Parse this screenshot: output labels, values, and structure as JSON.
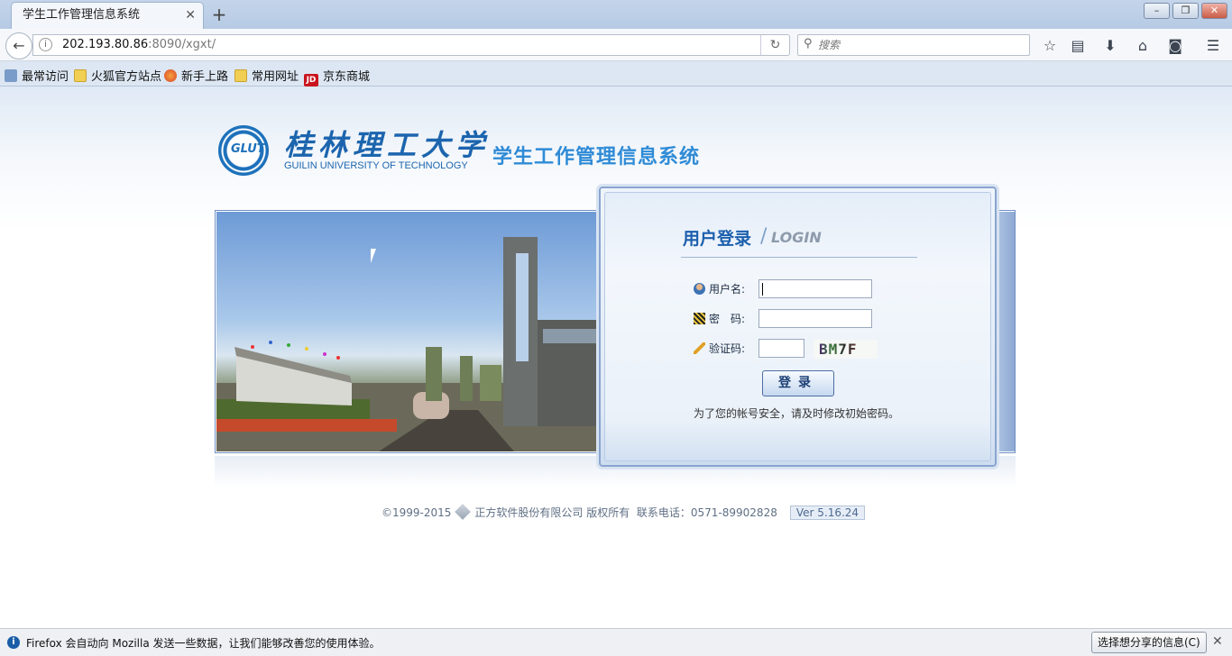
{
  "browser": {
    "tab_title": "学生工作管理信息系统",
    "tab_close": "✕",
    "new_tab": "+",
    "url_host": "202.193.80.86",
    "url_rest": ":8090/xgxt/",
    "search_placeholder": "搜索",
    "window_buttons": [
      "–",
      "❐",
      "✕"
    ],
    "bookmarks": [
      "最常访问",
      "火狐官方站点",
      "新手上路",
      "常用网址",
      "京东商城"
    ],
    "jd_label": "JD"
  },
  "header": {
    "school_name_cn": "桂林理工大学",
    "school_name_en": "GUILIN UNIVERSITY OF TECHNOLOGY",
    "seal_text": "GLUT",
    "system_title": "学生工作管理信息系统"
  },
  "login": {
    "title": "用户登录",
    "separator": "/",
    "title_en": "LOGIN",
    "username_label": "用户名:",
    "password_label": "密　码:",
    "captcha_label": "验证码:",
    "captcha_text": "BM7F",
    "submit_label": "登录",
    "hint": "为了您的帐号安全，请及时修改初始密码。"
  },
  "footer": {
    "copyright": "©1999-2015",
    "company": "正方软件股份有限公司 版权所有",
    "phone": "联系电话：0571-89902828",
    "version": "Ver 5.16.24"
  },
  "notification": {
    "message": "Firefox 会自动向 Mozilla 发送一些数据，让我们能够改善您的使用体验。",
    "share_button": "选择想分享的信息(C)",
    "close": "✕"
  },
  "colors": {
    "brand_blue": "#1c65ae",
    "system_title": "#2f8bd6"
  }
}
